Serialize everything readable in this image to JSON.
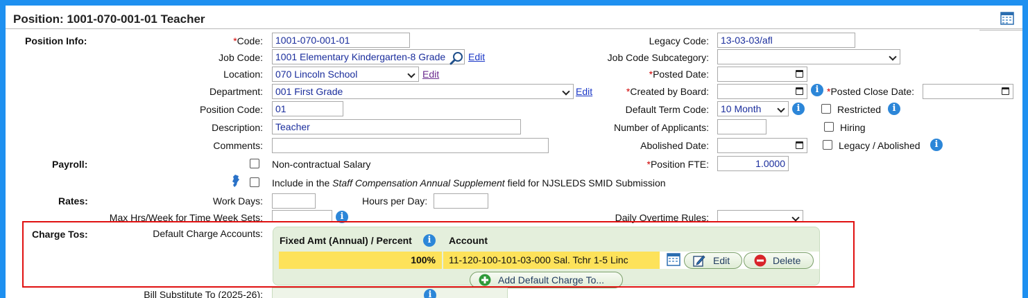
{
  "title": "Position: 1001-070-001-01 Teacher",
  "sections": {
    "position_info": "Position Info:",
    "payroll": "Payroll:",
    "rates": "Rates:",
    "charge_tos": "Charge Tos:"
  },
  "left_fields": {
    "code": {
      "label": "Code:",
      "value": "1001-070-001-01"
    },
    "job_code": {
      "label": "Job Code:",
      "value": "1001 Elementary Kindergarten-8 Grade",
      "link": "Edit"
    },
    "location": {
      "label": "Location:",
      "value": "070 Lincoln School",
      "link": "Edit"
    },
    "department": {
      "label": "Department:",
      "value": "001 First Grade",
      "link": "Edit"
    },
    "position_code": {
      "label": "Position Code:",
      "value": "01"
    },
    "description": {
      "label": "Description:",
      "value": "Teacher"
    },
    "comments": {
      "label": "Comments:",
      "value": ""
    }
  },
  "right_fields": {
    "legacy_code": {
      "label": "Legacy Code:",
      "value": "13-03-03/afl"
    },
    "job_code_subcategory": {
      "label": "Job Code Subcategory:",
      "value": ""
    },
    "posted_date": {
      "label": "Posted Date:",
      "value": ""
    },
    "created_by_board": {
      "label": "Created by Board:",
      "value": ""
    },
    "posted_close_date": {
      "label": "Posted Close Date:",
      "value": ""
    },
    "default_term_code": {
      "label": "Default Term Code:",
      "value": "10 Month"
    },
    "number_of_applicants": {
      "label": "Number of Applicants:",
      "value": ""
    },
    "abolished_date": {
      "label": "Abolished Date:",
      "value": ""
    },
    "position_fte": {
      "label": "Position FTE:",
      "value": "1.0000"
    },
    "daily_overtime_rules": {
      "label": "Daily Overtime Rules:",
      "value": ""
    }
  },
  "checkboxes": {
    "restricted": {
      "label": "Restricted",
      "checked": false
    },
    "hiring": {
      "label": "Hiring",
      "checked": false
    },
    "legacy_abolished": {
      "label": "Legacy / Abolished",
      "checked": false
    },
    "non_contractual": {
      "label": "Non-contractual Salary",
      "checked": false
    },
    "nj_include": {
      "pre": "Include in the ",
      "em": "Staff Compensation Annual Supplement",
      "post": " field for NJSLEDS SMID Submission",
      "checked": false
    }
  },
  "rates": {
    "work_days": {
      "label": "Work Days:",
      "value": ""
    },
    "hours_per_day": {
      "label": "Hours per Day:",
      "value": ""
    },
    "max_hrs": {
      "label": "Max Hrs/Week for Time Week Sets:",
      "value": ""
    }
  },
  "charge_tos": {
    "label": "Default Charge Accounts:",
    "col_pct": "Fixed Amt (Annual) / Percent",
    "col_account": "Account",
    "rows": [
      {
        "percent": "100%",
        "account": "11-120-100-101-03-000 Sal. Tchr 1-5 Linc"
      }
    ],
    "edit_label": "Edit",
    "delete_label": "Delete",
    "add_label": "Add Default Charge To..."
  },
  "cutoff_label": "Bill Substitute To (2025-26):"
}
